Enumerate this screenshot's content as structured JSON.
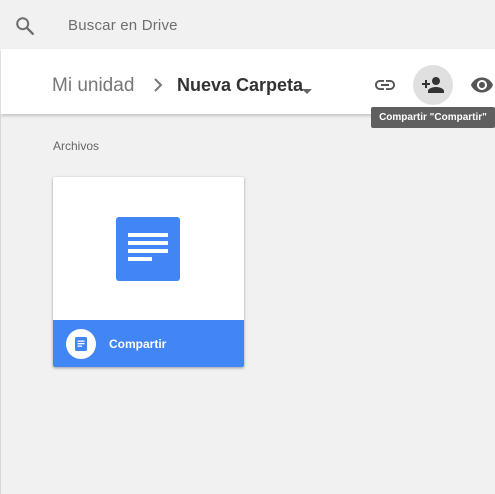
{
  "search": {
    "placeholder": "Buscar en Drive",
    "icon": "search-icon"
  },
  "breadcrumb": {
    "root": "Mi unidad",
    "separator_icon": "chevron-right-icon",
    "current": "Nueva Carpeta",
    "caret_icon": "caret-down-icon"
  },
  "toolbar": {
    "link_icon": "link-icon",
    "share_icon": "person-add-icon",
    "preview_icon": "eye-icon"
  },
  "tooltip": {
    "text": "Compartir \"Compartir\""
  },
  "section": {
    "label": "Archivos"
  },
  "files": [
    {
      "title": "Compartir",
      "type_icon": "google-doc-icon"
    }
  ],
  "colors": {
    "accent": "#4285f4",
    "background": "#f1f1f1",
    "tooltip_bg": "#5f5f5f"
  }
}
